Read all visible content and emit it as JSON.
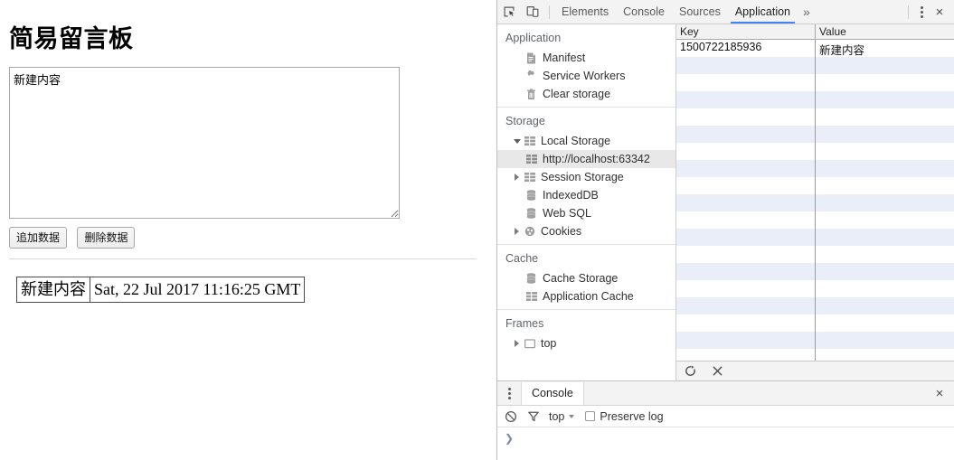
{
  "page": {
    "title": "简易留言板",
    "textarea_value": "新建内容",
    "buttons": [
      {
        "label": "追加数据",
        "name": "add-data-button"
      },
      {
        "label": "删除数据",
        "name": "delete-data-button"
      }
    ],
    "notes_table": {
      "rows": [
        {
          "content": "新建内容",
          "timestamp": "Sat, 22 Jul 2017 11:16:25 GMT"
        }
      ]
    }
  },
  "devtools": {
    "toolbar": {
      "inspect_icon": "inspect-element-icon",
      "device_icon": "device-toolbar-icon",
      "more_tabs": "»",
      "kebab": "main-menu-icon",
      "close": "×"
    },
    "tabs": [
      {
        "label": "Elements",
        "active": false
      },
      {
        "label": "Console",
        "active": false
      },
      {
        "label": "Sources",
        "active": false
      },
      {
        "label": "Application",
        "active": true
      }
    ],
    "accent_color": "#4285f4",
    "sidebar": {
      "sections": [
        {
          "title": "Application",
          "items": [
            {
              "label": "Manifest",
              "icon": "manifest-icon",
              "twisty": "none",
              "selected": false,
              "indent": 1
            },
            {
              "label": "Service Workers",
              "icon": "gear-icon",
              "twisty": "none",
              "selected": false,
              "indent": 1
            },
            {
              "label": "Clear storage",
              "icon": "trash-icon",
              "twisty": "none",
              "selected": false,
              "indent": 1
            }
          ]
        },
        {
          "title": "Storage",
          "items": [
            {
              "label": "Local Storage",
              "icon": "table-icon",
              "twisty": "down",
              "selected": false,
              "indent": 1
            },
            {
              "label": "http://localhost:63342",
              "icon": "table-icon",
              "twisty": "none",
              "selected": true,
              "indent": 2
            },
            {
              "label": "Session Storage",
              "icon": "table-icon",
              "twisty": "right",
              "selected": false,
              "indent": 1
            },
            {
              "label": "IndexedDB",
              "icon": "database-icon",
              "twisty": "none",
              "selected": false,
              "indent": 1
            },
            {
              "label": "Web SQL",
              "icon": "database-icon",
              "twisty": "none",
              "selected": false,
              "indent": 1
            },
            {
              "label": "Cookies",
              "icon": "cookie-icon",
              "twisty": "right",
              "selected": false,
              "indent": 1
            }
          ]
        },
        {
          "title": "Cache",
          "items": [
            {
              "label": "Cache Storage",
              "icon": "database-icon",
              "twisty": "none",
              "selected": false,
              "indent": 1
            },
            {
              "label": "Application Cache",
              "icon": "table-icon",
              "twisty": "none",
              "selected": false,
              "indent": 1
            }
          ]
        },
        {
          "title": "Frames",
          "items": [
            {
              "label": "top",
              "icon": "frame-icon",
              "twisty": "right",
              "selected": false,
              "indent": 1
            }
          ]
        }
      ]
    },
    "storage_table": {
      "columns": [
        "Key",
        "Value"
      ],
      "rows": [
        {
          "key": "1500722185936",
          "value": "新建内容"
        }
      ],
      "empty_row_count": 18,
      "stripe_color": "#e9eef8",
      "toolbar": {
        "refresh_icon": "refresh-icon",
        "delete_icon": "delete-selected-icon"
      }
    },
    "drawer": {
      "kebab_icon": "drawer-menu-icon",
      "tab_label": "Console",
      "close_icon": "×",
      "console_toolbar": {
        "clear_icon": "clear-console-icon",
        "filter_icon": "filter-icon",
        "context_value": "top",
        "preserve_log_label": "Preserve log",
        "preserve_log_checked": false
      },
      "prompt_caret": "❯"
    }
  }
}
